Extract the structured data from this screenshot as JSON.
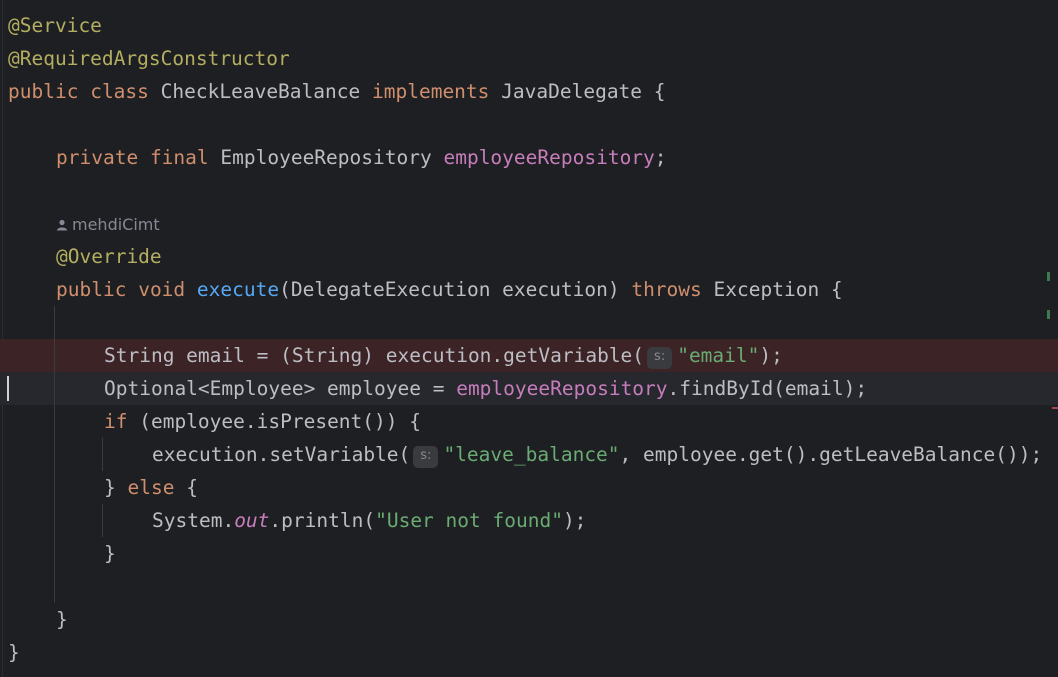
{
  "editor": {
    "line_annotation_service": "@Service",
    "line_annotation_rac": "@RequiredArgsConstructor",
    "class_decl": {
      "kw_public": "public",
      "kw_class": "class",
      "class_name": "CheckLeaveBalance",
      "kw_implements": "implements",
      "iface": "JavaDelegate",
      "brace": " {"
    },
    "field_decl": {
      "kw_private": "private",
      "kw_final": "final",
      "type": "EmployeeRepository",
      "name": "employeeRepository",
      "semi": ";"
    },
    "author": "mehdiCimt",
    "override": "@Override",
    "method_decl": {
      "kw_public": "public",
      "kw_void": "void",
      "name": "execute",
      "params": "(DelegateExecution execution)",
      "kw_throws": "throws",
      "exception": "Exception {"
    },
    "line_email": {
      "before": "String email = (String) execution.getVariable(",
      "hint": "s:",
      "str": "\"email\"",
      "after": ");"
    },
    "line_optional": {
      "before": "Optional<Employee> employee = ",
      "field": "employeeRepository",
      "after": ".findById(email);"
    },
    "line_if": {
      "kw_if": "if",
      "rest": " (employee.isPresent()) {"
    },
    "line_setvar": {
      "before": "execution.setVariable(",
      "hint": "s:",
      "str": "\"leave_balance\"",
      "after": ", employee.get().getLeaveBalance());"
    },
    "line_else": {
      "open": "} ",
      "kw_else": "else",
      "rest": " {"
    },
    "line_println": {
      "before": "System.",
      "static_field": "out",
      "mid": ".println(",
      "str": "\"User not found\"",
      "after": ");"
    },
    "close_if": "}",
    "close_method": "}",
    "close_class": "}"
  },
  "colors": {
    "background": "#1e1f22",
    "keyword": "#cf8e6d",
    "annotation": "#b3ae60",
    "field": "#c77dbb",
    "method": "#56a8f5",
    "string": "#6aab73",
    "breakpoint_line": "#3b2326"
  },
  "icons": {
    "author": "person-icon"
  }
}
